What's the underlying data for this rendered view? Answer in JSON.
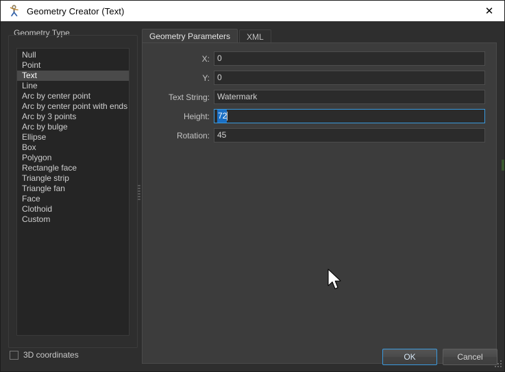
{
  "window": {
    "title": "Geometry Creator (Text)",
    "icon": "app-figure-icon",
    "close_label": "✕"
  },
  "left_panel": {
    "group_title": "Geometry Type",
    "selected_index": 2,
    "items": [
      "Null",
      "Point",
      "Text",
      "Line",
      "Arc by center point",
      "Arc by center point with ends",
      "Arc by 3 points",
      "Arc by bulge",
      "Ellipse",
      "Box",
      "Polygon",
      "Rectangle face",
      "Triangle strip",
      "Triangle fan",
      "Face",
      "Clothoid",
      "Custom"
    ]
  },
  "tabs": [
    {
      "label": "Geometry Parameters",
      "active": true
    },
    {
      "label": "XML",
      "active": false
    }
  ],
  "form": {
    "rows": [
      {
        "label": "X:",
        "value": "0",
        "focused": false
      },
      {
        "label": "Y:",
        "value": "0",
        "focused": false
      },
      {
        "label": "Text String:",
        "value": "Watermark",
        "focused": false
      },
      {
        "label": "Height:",
        "value": "72",
        "focused": true,
        "selected": true
      },
      {
        "label": "Rotation:",
        "value": "45",
        "focused": false
      }
    ]
  },
  "footer": {
    "checkbox_label": "3D coordinates",
    "checkbox_checked": false,
    "ok_label": "OK",
    "cancel_label": "Cancel"
  },
  "colors": {
    "window_bg": "#2e2e2e",
    "panel_bg": "#3c3c3c",
    "list_bg": "#252525",
    "input_bg": "#2b2b2b",
    "accent_focus": "#3a9ade",
    "selection": "#1a6fc4",
    "list_selection": "#4a4a4a",
    "text": "#c8c8c8",
    "titlebar_bg": "#ffffff",
    "titlebar_text": "#000000"
  }
}
